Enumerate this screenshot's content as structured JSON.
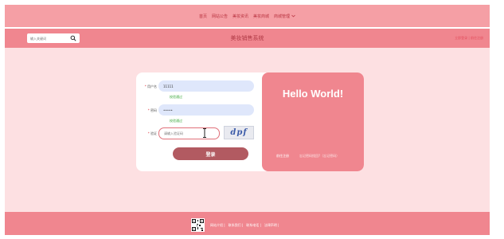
{
  "nav": {
    "items": [
      "首页",
      "网站公告",
      "美妆资讯",
      "美妆商城"
    ],
    "dropdown_label": "商城管理",
    "dropdown_icon": "chevron-down-icon"
  },
  "header": {
    "search_placeholder": "输入关键词",
    "site_title": "美妆销售系统",
    "user_links": "立即登录 | 前往注册"
  },
  "login": {
    "username_label": "用户名",
    "username_value": "11111",
    "username_hint": "校验通过",
    "password_label": "密码",
    "password_value": "•••••",
    "password_hint": "校验通过",
    "captcha_label": "验证",
    "captcha_placeholder": "请输入验证码",
    "captcha_text": "dpf",
    "submit_label": "登录"
  },
  "panel": {
    "greeting": "Hello World!",
    "register_link": "前往注册",
    "forgot_link": "忘记密码找回?（忘记密码）"
  },
  "footer": {
    "links": [
      "网站介绍 |",
      "联系我们 |",
      "联系电话 |",
      "法律声明 |"
    ]
  },
  "colors": {
    "nav_bg": "#f59fa5",
    "header_bg": "#f0868f",
    "content_bg": "#fde0e2",
    "button": "#b25a61",
    "hint_green": "#3aa83a"
  }
}
